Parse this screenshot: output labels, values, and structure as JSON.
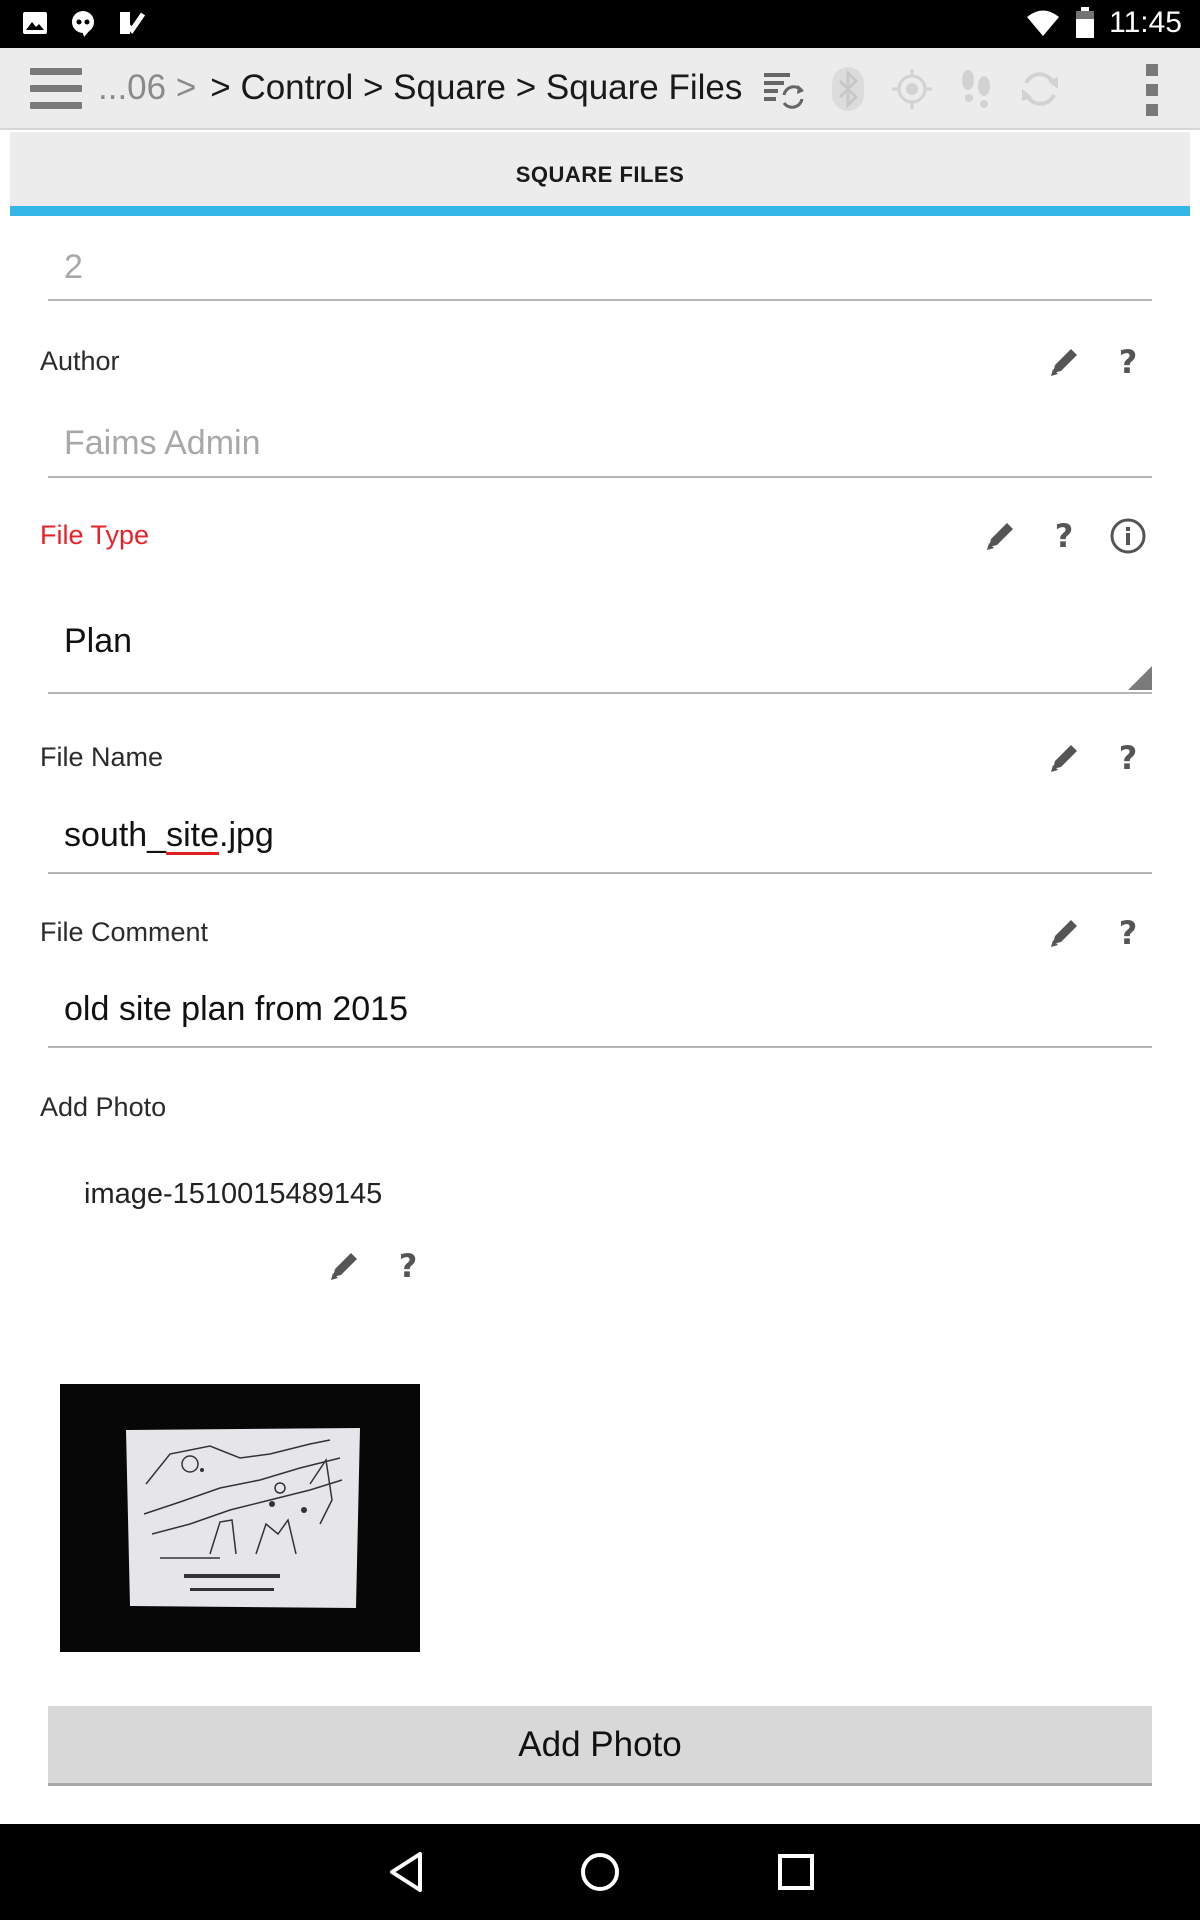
{
  "status_bar": {
    "time": "11:45",
    "left_icons": [
      "image-icon",
      "hangouts-icon",
      "checkmark-notification-icon"
    ],
    "right_icons": [
      "wifi-icon",
      "battery-icon"
    ]
  },
  "action_bar": {
    "breadcrumb_prefix": "...06 >",
    "breadcrumb_path": "> Control > Square > Square Files",
    "icons": [
      "sync-list-icon",
      "bluetooth-icon",
      "gps-icon",
      "footsteps-icon",
      "refresh-icon",
      "overflow-menu-icon"
    ]
  },
  "tab": {
    "label": "SQUARE FILES",
    "accent_color": "#33b5e5"
  },
  "form": {
    "top_field_value": "2",
    "author": {
      "label": "Author",
      "value": "Faims Admin"
    },
    "file_type": {
      "label": "File Type",
      "value": "Plan",
      "label_color": "#e8222a"
    },
    "file_name": {
      "label": "File Name",
      "value_part1": "south_",
      "value_part2": "site",
      "value_part3": ".jpg"
    },
    "file_comment": {
      "label": "File Comment",
      "value": "old site plan from 2015"
    },
    "add_photo": {
      "label": "Add Photo",
      "photo_name": "image-1510015489145",
      "button_label": "Add Photo"
    }
  },
  "help_symbol": "?",
  "nav_bar": {
    "buttons": [
      "back-icon",
      "home-icon",
      "recents-icon"
    ]
  }
}
